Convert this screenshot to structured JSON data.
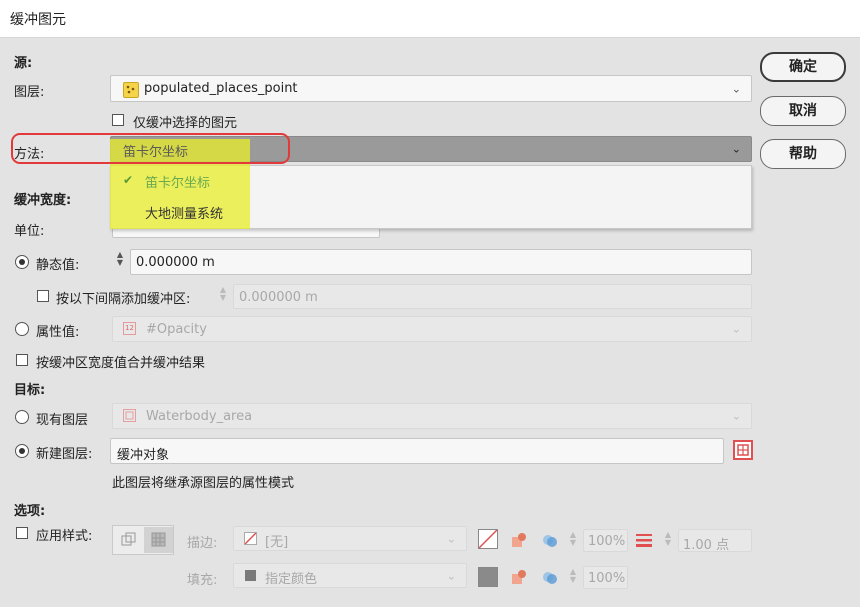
{
  "window": {
    "title": "缓冲图元"
  },
  "source": {
    "heading": "源:",
    "layer_label": "图层:",
    "layer_value": "populated_places_point",
    "selected_only_label": "仅缓冲选择的图元",
    "method_label": "方法:",
    "method_value": "笛卡尔坐标",
    "method_options": [
      {
        "label": "笛卡尔坐标",
        "checked": true
      },
      {
        "label": "大地测量系统",
        "checked": false
      }
    ]
  },
  "width": {
    "heading": "缓冲宽度:",
    "unit_label": "单位:",
    "static_label": "静态值:",
    "static_value": "0.000000 m",
    "interval_label": "按以下间隔添加缓冲区:",
    "interval_value": "0.000000 m",
    "attribute_label": "属性值:",
    "attribute_value": "#Opacity",
    "merge_label": "按缓冲区宽度值合并缓冲结果"
  },
  "target": {
    "heading": "目标:",
    "existing_label": "现有图层",
    "existing_value": "Waterbody_area",
    "new_label": "新建图层:",
    "new_value": "缓冲对象",
    "inherit_note": "此图层将继承源图层的属性模式"
  },
  "options": {
    "heading": "选项:",
    "apply_style_label": "应用样式:",
    "stroke_label": "描边:",
    "stroke_value": "[无]",
    "stroke_opacity": "100%",
    "stroke_width": "1.00 点",
    "fill_label": "填充:",
    "fill_value": "指定颜色",
    "fill_opacity": "100%"
  },
  "buttons": {
    "ok": "确定",
    "cancel": "取消",
    "help": "帮助"
  },
  "colors": {
    "highlight": "#e8ee28",
    "annotation_red": "#e23a3a",
    "layer_icon_yellow": "#f5d34a",
    "target_icon_red": "#e05050"
  }
}
